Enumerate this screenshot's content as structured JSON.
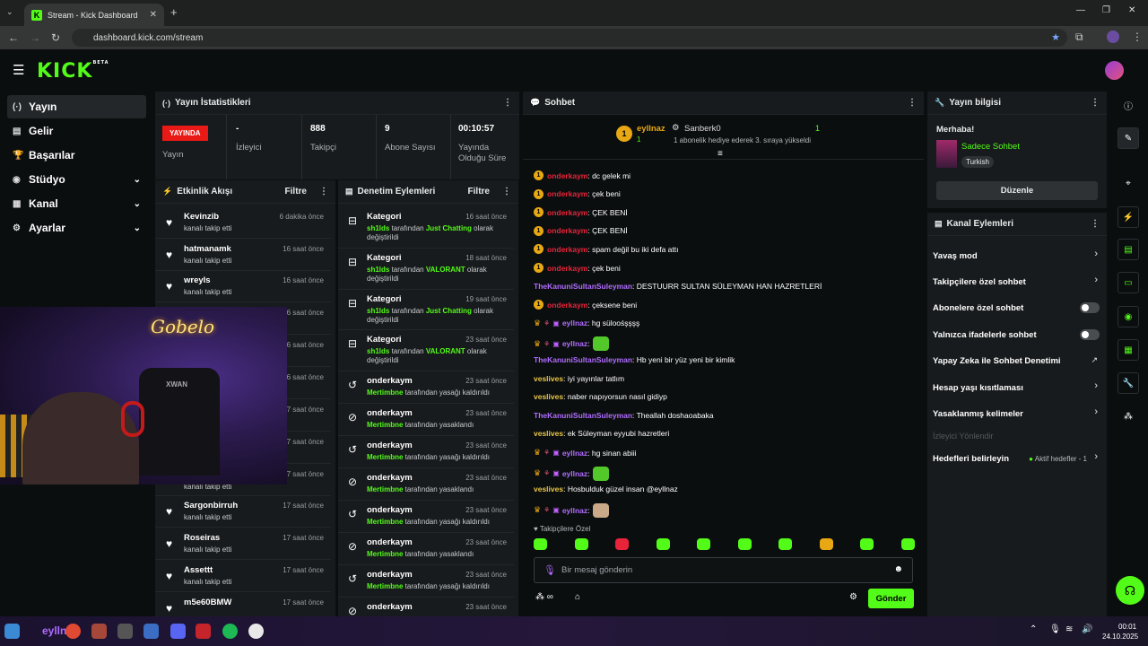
{
  "browser": {
    "tab_title": "Stream - Kick Dashboard",
    "tab_favicon": "K",
    "url": "dashboard.kick.com/stream",
    "min_icon": "—",
    "max_icon": "❐",
    "close_icon": "✕"
  },
  "header": {
    "logo": "KICK",
    "beta": "BETA"
  },
  "sidebar": {
    "items": [
      {
        "label": "Yayın",
        "icon": "(·)"
      },
      {
        "label": "Gelir",
        "icon": "▤"
      },
      {
        "label": "Başarılar",
        "icon": "🏆"
      },
      {
        "label": "Stüdyo",
        "icon": "◉",
        "chevron": "⌄"
      },
      {
        "label": "Kanal",
        "icon": "▦",
        "chevron": "⌄"
      },
      {
        "label": "Ayarlar",
        "icon": "⚙",
        "chevron": "⌄"
      }
    ]
  },
  "stats": {
    "title": "Yayın İstatistikleri",
    "live_badge": "YAYINDA",
    "live_label": "Yayın",
    "viewers_value": "-",
    "viewers_label": "İzleyici",
    "followers_value": "888",
    "followers_label": "Takipçi",
    "subs_value": "9",
    "subs_label": "Abone Sayısı",
    "uptime_value": "00:10:57",
    "uptime_label": "Yayında Olduğu Süre"
  },
  "activity": {
    "title": "Etkinlik Akışı",
    "filter": "Filtre",
    "items": [
      {
        "name": "Kevinzib",
        "text": "kanalı takip etti",
        "time": "6 dakika önce"
      },
      {
        "name": "hatmanamk",
        "text": "kanalı takip etti",
        "time": "16 saat önce"
      },
      {
        "name": "wreyls",
        "text": "kanalı takip etti",
        "time": "16 saat önce"
      },
      {
        "name": "",
        "text": "",
        "time": "6 saat önce"
      },
      {
        "name": "",
        "text": "",
        "time": "6 saat önce"
      },
      {
        "name": "",
        "text": "",
        "time": "6 saat önce"
      },
      {
        "name": "",
        "text": "",
        "time": "17 saat önce"
      },
      {
        "name": "",
        "text": "",
        "time": "17 saat önce"
      },
      {
        "name": "",
        "text": "kanalı takip etti",
        "time": "17 saat önce"
      },
      {
        "name": "Sargonbirruh",
        "text": "kanalı takip etti",
        "time": "17 saat önce"
      },
      {
        "name": "Roseiras",
        "text": "kanalı takip etti",
        "time": "17 saat önce"
      },
      {
        "name": "Assettt",
        "text": "kanalı takip etti",
        "time": "17 saat önce"
      },
      {
        "name": "m5e60BMW",
        "text": "",
        "time": "17 saat önce"
      }
    ]
  },
  "moderation": {
    "title": "Denetim Eylemleri",
    "filter": "Filtre",
    "items": [
      {
        "name": "Kategori",
        "user": "sh1lds",
        "mid": " tarafından ",
        "game": "Just Chatting",
        "tail": " olarak değiştirildi",
        "time": "16 saat önce"
      },
      {
        "name": "Kategori",
        "user": "sh1lds",
        "mid": " tarafından ",
        "game": "VALORANT",
        "tail": " olarak değiştirildi",
        "time": "18 saat önce"
      },
      {
        "name": "Kategori",
        "user": "sh1lds",
        "mid": " tarafından ",
        "game": "Just Chatting",
        "tail": " olarak değiştirildi",
        "time": "19 saat önce"
      },
      {
        "name": "Kategori",
        "user": "sh1lds",
        "mid": " tarafından ",
        "game": "VALORANT",
        "tail": " olarak değiştirildi",
        "time": "23 saat önce"
      },
      {
        "name": "onderkaym",
        "user": "Mertimbne",
        "mid": "",
        "game": "",
        "tail": " tarafından yasağı kaldırıldı",
        "time": "23 saat önce"
      },
      {
        "name": "onderkaym",
        "user": "Mertimbne",
        "mid": "",
        "game": "",
        "tail": " tarafından yasaklandı",
        "time": "23 saat önce"
      },
      {
        "name": "onderkaym",
        "user": "Mertimbne",
        "mid": "",
        "game": "",
        "tail": " tarafından yasağı kaldırıldı",
        "time": "23 saat önce"
      },
      {
        "name": "onderkaym",
        "user": "Mertimbne",
        "mid": "",
        "game": "",
        "tail": " tarafından yasaklandı",
        "time": "23 saat önce"
      },
      {
        "name": "onderkaym",
        "user": "Mertimbne",
        "mid": "",
        "game": "",
        "tail": " tarafından yasağı kaldırıldı",
        "time": "23 saat önce"
      },
      {
        "name": "onderkaym",
        "user": "Mertimbne",
        "mid": "",
        "game": "",
        "tail": " tarafından yasaklandı",
        "time": "23 saat önce"
      },
      {
        "name": "onderkaym",
        "user": "Mertimbne",
        "mid": "",
        "game": "",
        "tail": " tarafından yasağı kaldırıldı",
        "time": "23 saat önce"
      },
      {
        "name": "onderkaym",
        "user": "",
        "mid": "",
        "game": "",
        "tail": "",
        "time": "23 saat önce"
      }
    ]
  },
  "cam": {
    "neon": "Gobelo",
    "chair": "XWAN"
  },
  "chat": {
    "title": "Sohbet",
    "pinned_user": "eyllnaz",
    "pinned_count": "1",
    "gift_user": "Sanberk0",
    "gift_count": "1",
    "gift_text": "1 abonelik hediye ederek 3. sıraya yükseldi",
    "messages": [
      {
        "badge": "1",
        "user": "onderkaym",
        "color": "#e9243a",
        "text": ": dc gelek mi"
      },
      {
        "badge": "1",
        "user": "onderkaym",
        "color": "#e9243a",
        "text": ": çek beni"
      },
      {
        "badge": "1",
        "user": "onderkaym",
        "color": "#e9243a",
        "text": ": ÇEK BENİ"
      },
      {
        "badge": "1",
        "user": "onderkaym",
        "color": "#e9243a",
        "text": ": ÇEK BENİ"
      },
      {
        "badge": "1",
        "user": "onderkaym",
        "color": "#e9243a",
        "text": ": spam değil bu iki defa attı"
      },
      {
        "badge": "1",
        "user": "onderkaym",
        "color": "#e9243a",
        "text": ": çek beni"
      },
      {
        "badge": "",
        "user": "TheKanuniSultanSuleyman",
        "color": "#b06cff",
        "text": ": DESTUURR SULTAN SÜLEYMAN HAN HAZRETLERİ"
      },
      {
        "badge": "1",
        "user": "onderkaym",
        "color": "#e9243a",
        "text": ": çeksene beni"
      },
      {
        "badge": "crown",
        "user": "eyllnaz",
        "color": "#b06cff",
        "text": ": hg süloośşşşş"
      },
      {
        "badge": "crown",
        "user": "eyllnaz",
        "color": "#b06cff",
        "text": ":",
        "emote": "green"
      },
      {
        "badge": "",
        "user": "TheKanuniSultanSuleyman",
        "color": "#b06cff",
        "text": ": Hb yeni bir yüz yeni bir kimlik"
      },
      {
        "badge": "",
        "user": "veslives",
        "color": "#e8c547",
        "text": ": iyi yayınlar tatlım"
      },
      {
        "badge": "",
        "user": "veslives",
        "color": "#e8c547",
        "text": ": naber napıyorsun nasıl gidiyp"
      },
      {
        "badge": "",
        "user": "TheKanuniSultanSuleyman",
        "color": "#b06cff",
        "text": ": Theallah doshaoabaka"
      },
      {
        "badge": "",
        "user": "veslives",
        "color": "#e8c547",
        "text": ": ek Süleyman eyyubi hazretleri"
      },
      {
        "badge": "crown",
        "user": "eyllnaz",
        "color": "#b06cff",
        "text": ": hg sinan abiii"
      },
      {
        "badge": "crown",
        "user": "eyllnaz",
        "color": "#b06cff",
        "text": ":",
        "emote": "green"
      },
      {
        "badge": "",
        "user": "veslives",
        "color": "#e8c547",
        "text": ": Hosbulduk güzel insan @eyllnaz"
      },
      {
        "badge": "crown",
        "user": "eyllnaz",
        "color": "#b06cff",
        "text": ":",
        "emote": "cat"
      }
    ],
    "followers_only_label": "Takipçilere Özel",
    "input_placeholder": "Bir mesaj gönderin",
    "send_label": "Gönder",
    "infinity": "∞"
  },
  "stream_info": {
    "title": "Yayın bilgisi",
    "greeting": "Merhaba!",
    "stream_title": "Sadece Sohbet",
    "language": "Turkish",
    "edit_label": "Düzenle"
  },
  "channel_actions": {
    "title": "Kanal Eylemleri",
    "slow_mode": "Yavaş mod",
    "followers_only": "Takipçilere özel sohbet",
    "subs_only": "Abonelere özel sohbet",
    "emotes_only": "Yalnızca ifadelerle sohbet",
    "ai_moderation": "Yapay Zeka ile Sohbet Denetimi",
    "account_age": "Hesap yaşı kısıtlaması",
    "banned_words": "Yasaklanmış kelimeler",
    "redirect": "İzleyici Yönlendir",
    "goals": "Hedefleri belirleyin",
    "goals_status": "Aktif hedefler - 1"
  },
  "taskbar": {
    "label": "eyllnaz",
    "time": "00:01",
    "date": "24.10.2025"
  },
  "colors": {
    "accent": "#53fc18",
    "live": "#e91916"
  }
}
